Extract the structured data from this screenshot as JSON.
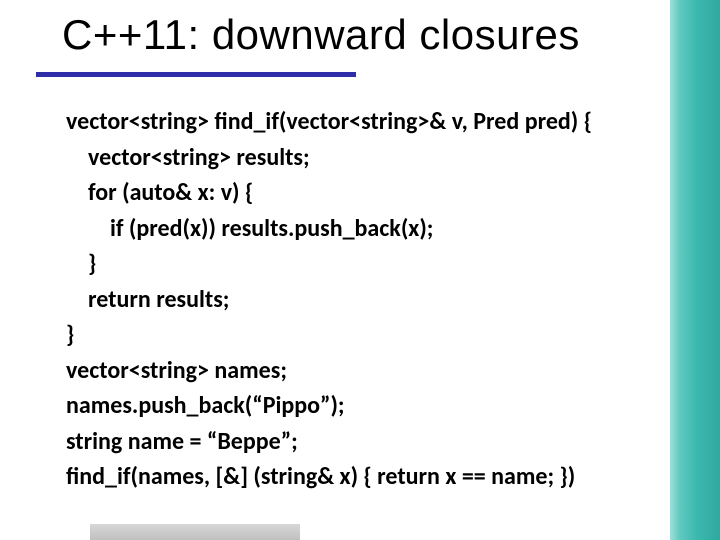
{
  "slide": {
    "title": "C++11: downward closures",
    "code": {
      "l0": "vector<string> find_if(vector<string>& v, Pred pred) {",
      "l1": "vector<string> results;",
      "l2": "for (auto& x: v) {",
      "l3": "if (pred(x)) results.push_back(x);",
      "l4": "}",
      "l5": "return results;",
      "l6": "}",
      "l7": "vector<string> names;",
      "l8": "names.push_back(“Pippo”);",
      "l9": "string name = “Beppe”;",
      "l10": "find_if(names, [&] (string& x) { return x == name; })"
    }
  },
  "colors": {
    "rule": "#2e2ea8",
    "accent": "#3bb8ae"
  }
}
